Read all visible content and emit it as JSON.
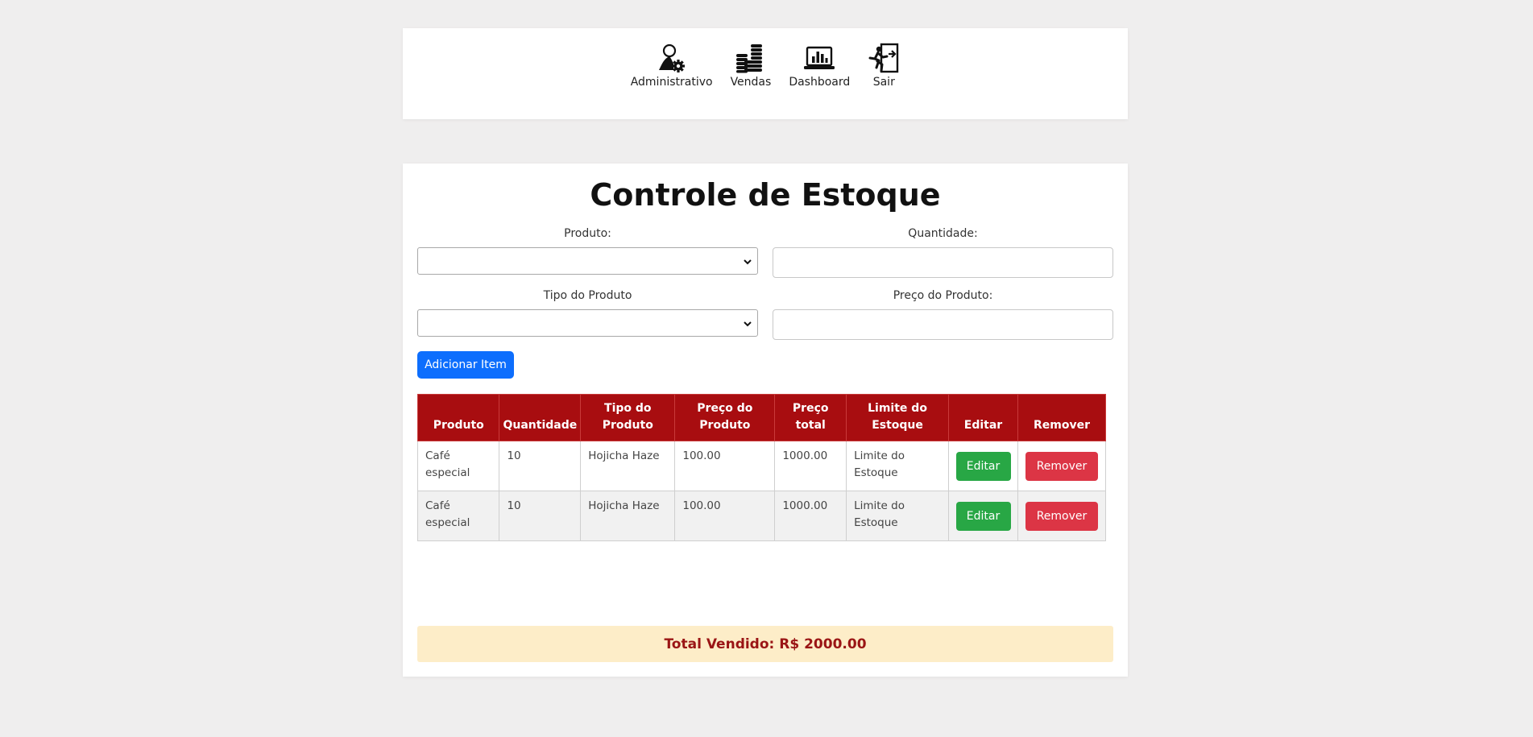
{
  "nav": {
    "items": [
      {
        "label": "Administrativo",
        "icon": "admin-gear-icon"
      },
      {
        "label": "Vendas",
        "icon": "coins-stack-icon"
      },
      {
        "label": "Dashboard",
        "icon": "laptop-chart-icon"
      },
      {
        "label": "Sair",
        "icon": "exit-door-icon"
      }
    ]
  },
  "main": {
    "title": "Controle de Estoque",
    "form": {
      "produto_label": "Produto:",
      "produto_value": "",
      "quantidade_label": "Quantidade:",
      "quantidade_value": "",
      "tipo_label": "Tipo do Produto",
      "tipo_value": "",
      "preco_label": "Preço do Produto:",
      "preco_value": "",
      "add_button": "Adicionar Item"
    },
    "table": {
      "headers": [
        "Produto",
        "Quantidade",
        "Tipo do Produto",
        "Preço do Produto",
        "Preço total",
        "Limite do Estoque",
        "Editar",
        "Remover"
      ],
      "rows": [
        {
          "produto": "Café especial",
          "quantidade": "10",
          "tipo": "Hojicha Haze",
          "preco": "100.00",
          "total": "1000.00",
          "limite": "Limite do Estoque",
          "edit": "Editar",
          "remove": "Remover"
        },
        {
          "produto": "Café especial",
          "quantidade": "10",
          "tipo": "Hojicha Haze",
          "preco": "100.00",
          "total": "1000.00",
          "limite": "Limite do Estoque",
          "edit": "Editar",
          "remove": "Remover"
        }
      ]
    },
    "total_label": "Total Vendido: R$ 2000.00"
  },
  "colors": {
    "page_bg": "#efeeee",
    "primary": "#0d6efd",
    "table_header": "#a80d10",
    "edit": "#28a745",
    "remove": "#dc3545",
    "total_bg": "#fdedc8",
    "total_text": "#9a1515"
  }
}
